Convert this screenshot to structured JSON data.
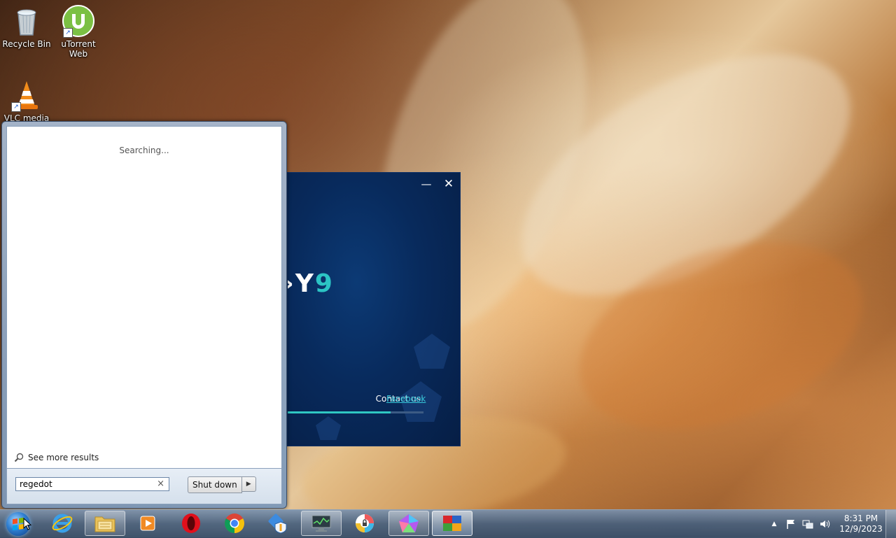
{
  "desktop": {
    "icons": [
      {
        "label": "Recycle Bin",
        "icon": "recycle-bin-icon"
      },
      {
        "label": "uTorrent Web",
        "icon": "utorrent-icon"
      },
      {
        "label": "VLC media",
        "icon": "vlc-icon"
      }
    ]
  },
  "start_menu": {
    "status_text": "Searching...",
    "see_more_label": "See more results",
    "search_value": "regedot",
    "clear_symbol": "×",
    "shutdown_label": "Shut down",
    "shutdown_arrow": "▶"
  },
  "splash": {
    "logo_text": "›Y",
    "logo_number": "9",
    "contact_label": "Contact us:",
    "facebook_link": "Facebook",
    "progress": 0.76,
    "minimize_symbol": "—",
    "close_symbol": "✕"
  },
  "taskbar": {
    "buttons": [
      {
        "icon": "internet-explorer-icon",
        "state": "normal"
      },
      {
        "icon": "file-explorer-icon",
        "state": "open"
      },
      {
        "icon": "media-player-icon",
        "state": "normal"
      },
      {
        "icon": "opera-icon",
        "state": "normal"
      },
      {
        "icon": "chrome-icon",
        "state": "normal"
      },
      {
        "icon": "network-shield-icon",
        "state": "normal"
      },
      {
        "icon": "monitor-app-icon",
        "state": "open"
      },
      {
        "icon": "vpn-lock-icon",
        "state": "normal"
      },
      {
        "icon": "pentagon-app-icon",
        "state": "open"
      },
      {
        "icon": "avg-icon",
        "state": "active"
      }
    ],
    "tray": {
      "show_hidden_symbol": "▲",
      "time": "8:31 PM",
      "date": "12/9/2023"
    }
  },
  "colors": {
    "splash_bg": "#082a5c",
    "accent_teal": "#2fc7c2",
    "link": "#35c7d9"
  }
}
